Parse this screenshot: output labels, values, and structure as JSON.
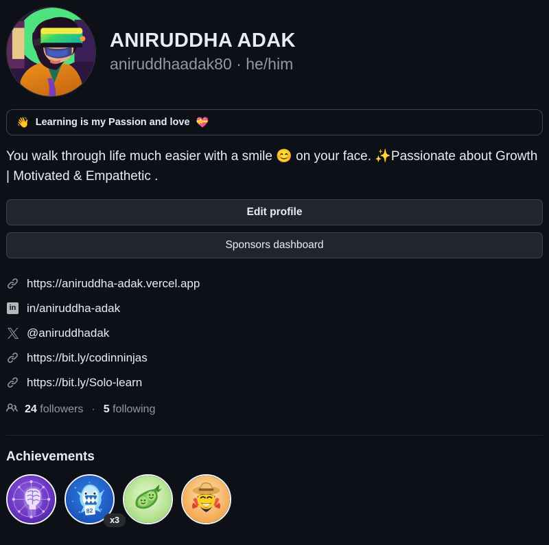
{
  "profile": {
    "avatar_alt": "avatar-vr-headset-portrait",
    "full_name": "ANIRUDDHA ADAK",
    "username": "aniruddhaadak80",
    "pronouns": "he/him",
    "handle_line": "aniruddhaadak80 · he/him"
  },
  "status": {
    "left_emoji": "👋",
    "text": "Learning is my Passion and love",
    "right_emoji": "💝"
  },
  "bio": "You walk through life much easier with a smile 😊 on your face. ✨Passionate about Growth | Motivated & Empathetic .",
  "buttons": {
    "edit_profile": "Edit profile",
    "sponsors_dashboard": "Sponsors dashboard"
  },
  "links": [
    {
      "icon": "link-icon",
      "label": "https://aniruddha-adak.vercel.app"
    },
    {
      "icon": "linkedin-icon",
      "label": "in/aniruddha-adak"
    },
    {
      "icon": "x-twitter-icon",
      "label": "@aniruddhadak"
    },
    {
      "icon": "link-icon",
      "label": "https://bit.ly/codinninjas"
    },
    {
      "icon": "link-icon",
      "label": "https://bit.ly/Solo-learn"
    }
  ],
  "social_counts": {
    "icon": "people-icon",
    "followers_count": "24",
    "followers_label": "followers",
    "separator": "·",
    "following_count": "5",
    "following_label": "following"
  },
  "achievements": {
    "title": "Achievements",
    "badges": [
      {
        "name": "galaxy-brain-badge",
        "count": ""
      },
      {
        "name": "pull-shark-badge",
        "count": "x3"
      },
      {
        "name": "pair-extraordinaire-badge",
        "count": ""
      },
      {
        "name": "quickdraw-badge",
        "count": ""
      }
    ]
  },
  "colors": {
    "page_bg": "#0d1117",
    "text": "#e6edf3",
    "muted": "#9198a1",
    "border": "#3d444d",
    "button_bg": "#21262d"
  }
}
